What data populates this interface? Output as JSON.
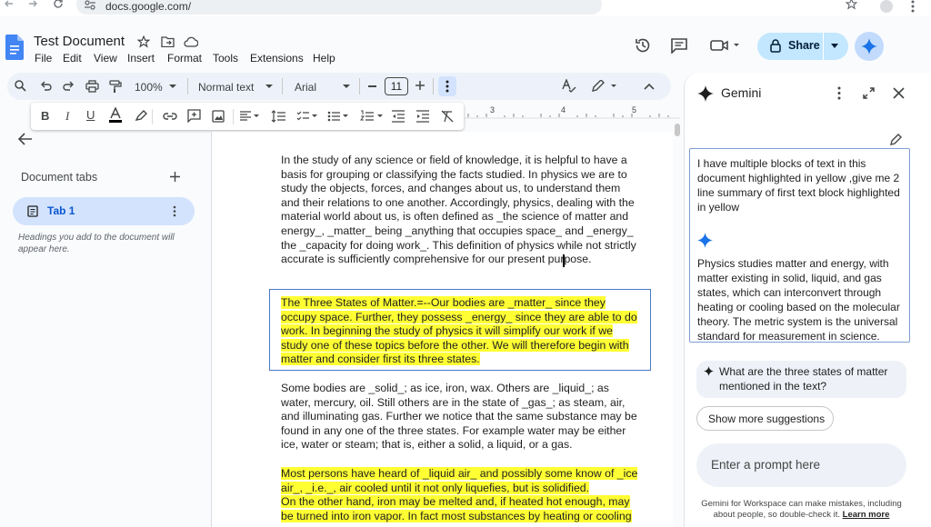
{
  "browser": {
    "url": "docs.google.com/"
  },
  "doc": {
    "title": "Test Document",
    "menu": [
      "File",
      "Edit",
      "View",
      "Insert",
      "Format",
      "Tools",
      "Extensions",
      "Help"
    ],
    "share_label": "Share"
  },
  "toolbar": {
    "zoom": "100%",
    "style": "Normal text",
    "font": "Arial",
    "font_size": "11"
  },
  "ruler": {
    "ticks": [
      "3",
      "4",
      "5",
      "6"
    ]
  },
  "sidebar": {
    "heading": "Document tabs",
    "tab_label": "Tab 1",
    "hint": "Headings you add to the document will appear here."
  },
  "body": {
    "p1": "In the study of any science or field of knowledge, it is helpful to have a basis for grouping or classifying the facts studied. In physics we are to study the objects, forces, and changes about us, to understand them and their relations to one another. Accordingly, physics, dealing with the material world about us, is often defined as _the science of matter and energy_, _matter_ being _anything that occupies space_ and _energy_ the _capacity for doing work_. This definition of physics while not strictly accurate is sufficiently comprehensive for our present purpose.",
    "p2": "The Three States of Matter.=--Our bodies are _matter_ since they occupy space. Further, they possess _energy_ since they are able to do work. In beginning the study of physics it will simplify our work if we study one of these topics before the other. We will therefore begin with matter and consider first its three states.",
    "p3": "Some bodies are _solid_; as ice, iron, wax. Others are _liquid_; as water, mercury, oil. Still others are in the state of _gas_; as steam, air, and illuminating gas. Further we notice that the same substance may be found in any one of the three states. For example water may be either ice, water or steam; that is, either a solid, a liquid, or a gas.",
    "p4a": "Most persons have heard of _liquid air_ and possibly some know of _ice air_, _i.e._, air cooled until it not only liquefies, but is solidified.",
    "p4b": "On the other hand, iron may be melted and, if heated hot enough, may be turned into iron vapor. In fact most substances by heating or cooling"
  },
  "gemini": {
    "title": "Gemini",
    "user_message": "I have multiple blocks of text in this document highlighted in yellow ,give me 2 line summary of first text block highlighted in yellow",
    "response": "Physics studies matter and energy, with matter existing in solid, liquid, and gas states, which can interconvert through heating or cooling based on the molecular theory. The metric system is the universal standard for measurement in science.",
    "suggestion": "What are the three states of matter mentioned in the text?",
    "more_suggestions": "Show more suggestions",
    "prompt_placeholder": "Enter a prompt here",
    "disclaimer": "Gemini for Workspace can make mistakes, including about people, so double-check it.",
    "learn_more": "Learn more"
  },
  "colors": {
    "highlight": "#ffff33",
    "accent": "#0b57d0",
    "share_bg": "#c2e7ff",
    "gemini_star": "#1a73e8"
  }
}
